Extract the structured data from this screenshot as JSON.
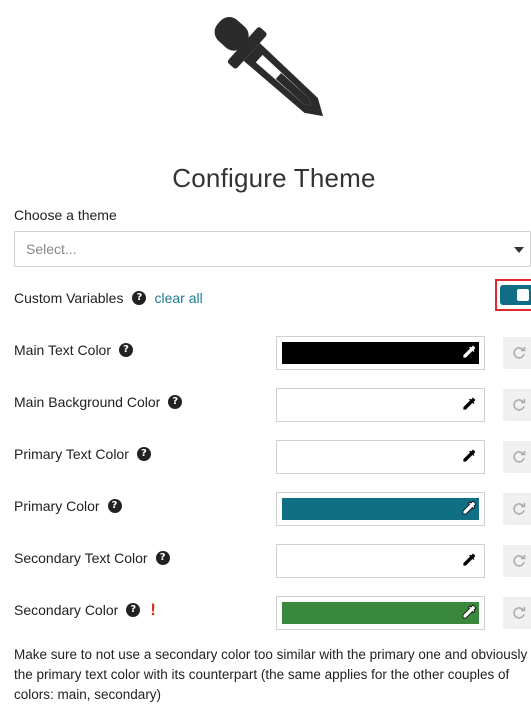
{
  "header": {
    "icon": "eyedropper-icon",
    "title": "Configure Theme"
  },
  "theme": {
    "label": "Choose a theme",
    "placeholder": "Select..."
  },
  "custom_variables": {
    "label": "Custom Variables",
    "clear_label": "clear all",
    "enabled": true
  },
  "colors": [
    {
      "label": "Main Text Color",
      "value": "#000000",
      "warning": ""
    },
    {
      "label": "Main Background Color",
      "value": "#ffffff",
      "warning": ""
    },
    {
      "label": "Primary Text Color",
      "value": "#ffffff",
      "warning": ""
    },
    {
      "label": "Primary Color",
      "value": "#116f85",
      "warning": ""
    },
    {
      "label": "Secondary Text Color",
      "value": "#ffffff",
      "warning": ""
    },
    {
      "label": "Secondary Color",
      "value": "#3a873e",
      "warning": "!"
    }
  ],
  "note": "Make sure to not use a secondary color too similar with the primary one and obviously the primary text color with its counterpart (the same applies for the other couples of colors: main, secondary)",
  "theme_colors": {
    "accent": "#1a7c94",
    "toggle": "#0f6e84",
    "highlight_border": "#e0262e",
    "warning": "#d93025"
  }
}
